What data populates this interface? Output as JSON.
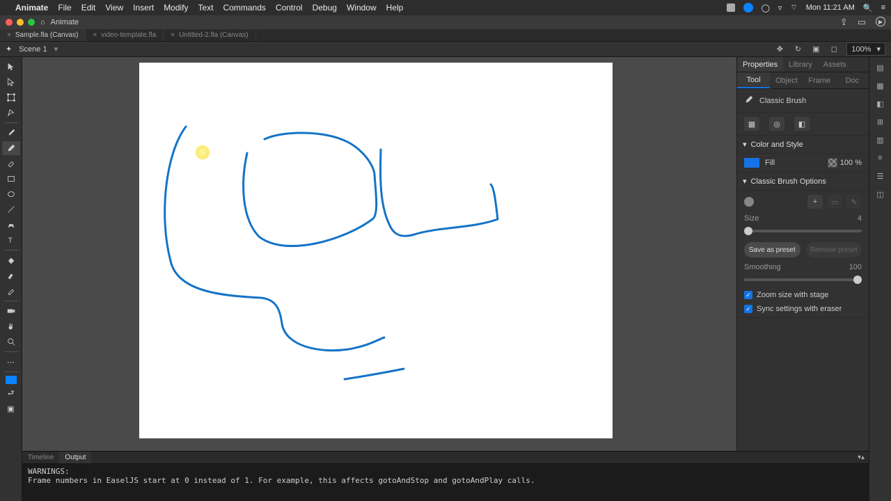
{
  "menubar": {
    "apple": "",
    "app": "Animate",
    "items": [
      "File",
      "Edit",
      "View",
      "Insert",
      "Modify",
      "Text",
      "Commands",
      "Control",
      "Debug",
      "Window",
      "Help"
    ],
    "clock": "Mon 11:21 AM"
  },
  "window": {
    "title": "Animate"
  },
  "doc_tabs": [
    {
      "label": "Sample.fla (Canvas)",
      "active": true
    },
    {
      "label": "video-template.fla",
      "active": false
    },
    {
      "label": "Untitled-2.fla (Canvas)",
      "active": false
    }
  ],
  "breadcrumb": {
    "scene": "Scene 1",
    "zoom": "100%"
  },
  "panel": {
    "tabs": [
      "Properties",
      "Library",
      "Assets"
    ],
    "active_tab": "Properties",
    "ctx_tabs": [
      "Tool",
      "Object",
      "Frame",
      "Doc"
    ],
    "active_ctx": "Tool",
    "tool_name": "Classic Brush",
    "color_section": "Color and Style",
    "fill_label": "Fill",
    "opacity": "100 %",
    "brush_section": "Classic Brush Options",
    "size_label": "Size",
    "size_value": "4",
    "save_preset": "Save as preset",
    "remove_preset": "Remove preset",
    "smoothing_label": "Smoothing",
    "smoothing_value": "100",
    "zoom_chk": "Zoom size with stage",
    "sync_chk": "Sync settings with eraser"
  },
  "left_tools": [
    "selection",
    "subselection",
    "free-transform",
    "lasso",
    "pen",
    "brush",
    "paint-brush",
    "eraser",
    "rectangle",
    "ellipse",
    "line",
    "polystar",
    "text",
    "fill",
    "paint-bucket",
    "eyedropper",
    "camera",
    "hand",
    "zoom"
  ],
  "bottom": {
    "tabs": [
      "Timeline",
      "Output"
    ],
    "active": "Output",
    "text": "WARNINGS:\nFrame numbers in EaselJS start at 0 instead of 1. For example, this affects gotoAndStop and gotoAndPlay calls."
  }
}
